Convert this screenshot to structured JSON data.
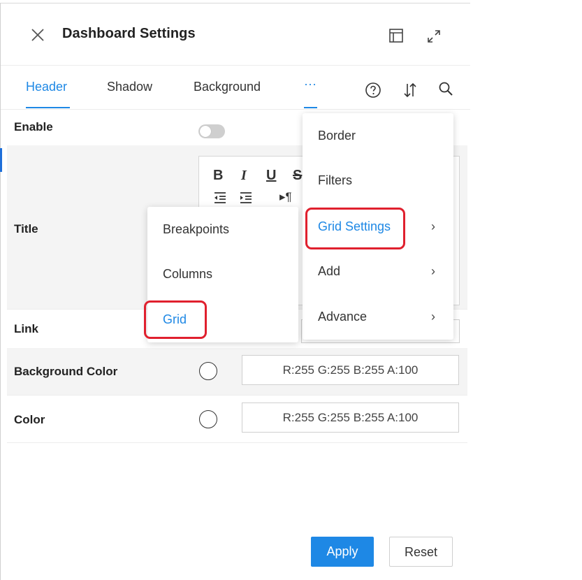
{
  "header": {
    "title": "Dashboard Settings",
    "icons": [
      "close-icon",
      "layout-icon",
      "expand-icon"
    ]
  },
  "tabs": {
    "items": [
      "Header",
      "Shadow",
      "Background",
      "···"
    ],
    "active": "Header",
    "tool_icons": [
      "help-icon",
      "sort-icon",
      "search-icon"
    ]
  },
  "rows": {
    "enable": "Enable",
    "title": "Title",
    "link": "Link",
    "background_color": "Background Color",
    "color": "Color"
  },
  "editor": {
    "bold": "B",
    "italic": "I",
    "underline": "U",
    "strike": "S",
    "ltr": "▸¶"
  },
  "values": {
    "background_color": "R:255 G:255 B:255 A:100",
    "color": "R:255 G:255 B:255 A:100"
  },
  "more_menu": {
    "items": [
      "Border",
      "Filters",
      "Grid Settings",
      "Add",
      "Advance"
    ],
    "highlighted": "Grid Settings",
    "chevron": "›"
  },
  "grid_submenu": {
    "items": [
      "Breakpoints",
      "Columns",
      "Grid"
    ],
    "highlighted": "Grid"
  },
  "footer": {
    "apply": "Apply",
    "reset": "Reset"
  },
  "colors": {
    "accent": "#1e88e5",
    "annotation": "#e0202e"
  }
}
